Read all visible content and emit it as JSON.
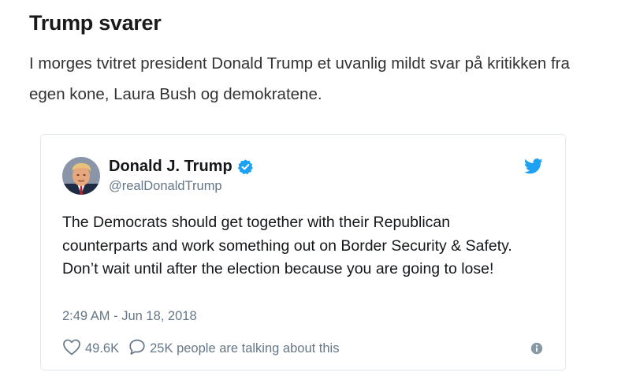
{
  "article": {
    "headline": "Trump svarer",
    "lead": "I morges tvitret president Donald Trump et uvanlig mildt svar på kritikken fra egen kone, Laura Bush og demokratene."
  },
  "tweet": {
    "author_name": "Donald J. Trump",
    "handle": "@realDonaldTrump",
    "verified": true,
    "text": "The Democrats should get together with their Republican counterparts and work something out on Border Security & Safety. Don’t wait until after the election because you are going to lose!",
    "timestamp": "2:49 AM - Jun 18, 2018",
    "likes": "49.6K",
    "replies_label": "25K people are talking about this",
    "icons": {
      "brand": "twitter-bird-icon",
      "verified": "verified-badge-icon",
      "like": "heart-icon",
      "reply": "speech-bubble-icon",
      "info": "info-icon"
    },
    "colors": {
      "brand": "#1da1f2",
      "secondary_text": "#657786",
      "border": "#e1e8ed"
    }
  }
}
